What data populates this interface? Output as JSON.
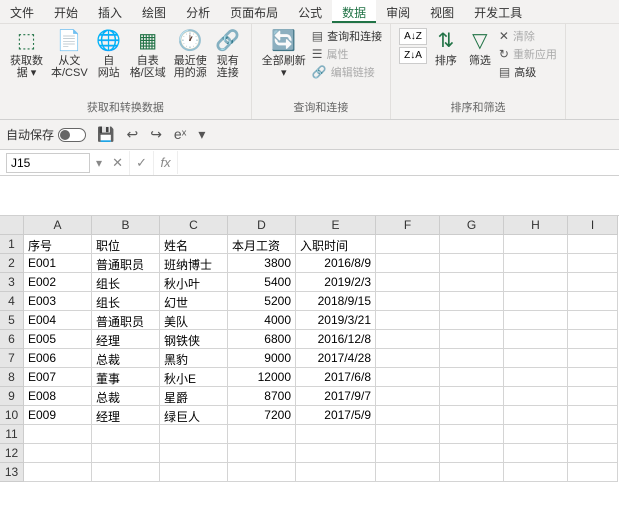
{
  "tabs": [
    "文件",
    "开始",
    "插入",
    "绘图",
    "分析",
    "页面布局",
    "公式",
    "数据",
    "审阅",
    "视图",
    "开发工具"
  ],
  "activeTab": "数据",
  "ribbon": {
    "group1": {
      "label": "获取和转换数据",
      "items": [
        {
          "l1": "获取数",
          "l2": "据 ▾"
        },
        {
          "l1": "从文",
          "l2": "本/CSV"
        },
        {
          "l1": "自",
          "l2": "网站"
        },
        {
          "l1": "自表",
          "l2": "格/区域"
        },
        {
          "l1": "最近使",
          "l2": "用的源"
        },
        {
          "l1": "现有",
          "l2": "连接"
        }
      ]
    },
    "group2": {
      "label": "查询和连接",
      "refresh": {
        "l1": "全部刷新",
        "l2": "▾"
      },
      "items": [
        "查询和连接",
        "属性",
        "编辑链接"
      ]
    },
    "group3": {
      "label": "排序和筛选",
      "sortAsc": "A↓Z",
      "sortDesc": "Z↓A",
      "sort": "排序",
      "filter": "筛选",
      "clear": "清除",
      "reapply": "重新应用",
      "advanced": "高级"
    }
  },
  "quickAccess": {
    "autosave": "自动保存",
    "items": [
      "💾",
      "↩",
      "↪",
      "eˣ",
      "▾"
    ]
  },
  "formulaBar": {
    "nameBox": "J15",
    "cancel": "✕",
    "confirm": "✓",
    "fx": "fx",
    "value": ""
  },
  "columns": [
    "A",
    "B",
    "C",
    "D",
    "E",
    "F",
    "G",
    "H",
    "I"
  ],
  "sheet": {
    "headers": [
      "序号",
      "职位",
      "姓名",
      "本月工资",
      "入职时间"
    ],
    "rows": [
      [
        "E001",
        "普通职员",
        "班纳博士",
        "3800",
        "2016/8/9"
      ],
      [
        "E002",
        "组长",
        "秋小叶",
        "5400",
        "2019/2/3"
      ],
      [
        "E003",
        "组长",
        "幻世",
        "5200",
        "2018/9/15"
      ],
      [
        "E004",
        "普通职员",
        "美队",
        "4000",
        "2019/3/21"
      ],
      [
        "E005",
        "经理",
        "钢铁侠",
        "6800",
        "2016/12/8"
      ],
      [
        "E006",
        "总裁",
        "黑豹",
        "9000",
        "2017/4/28"
      ],
      [
        "E007",
        "董事",
        "秋小E",
        "12000",
        "2017/6/8"
      ],
      [
        "E008",
        "总裁",
        "星爵",
        "8700",
        "2017/9/7"
      ],
      [
        "E009",
        "经理",
        "绿巨人",
        "7200",
        "2017/5/9"
      ]
    ]
  }
}
